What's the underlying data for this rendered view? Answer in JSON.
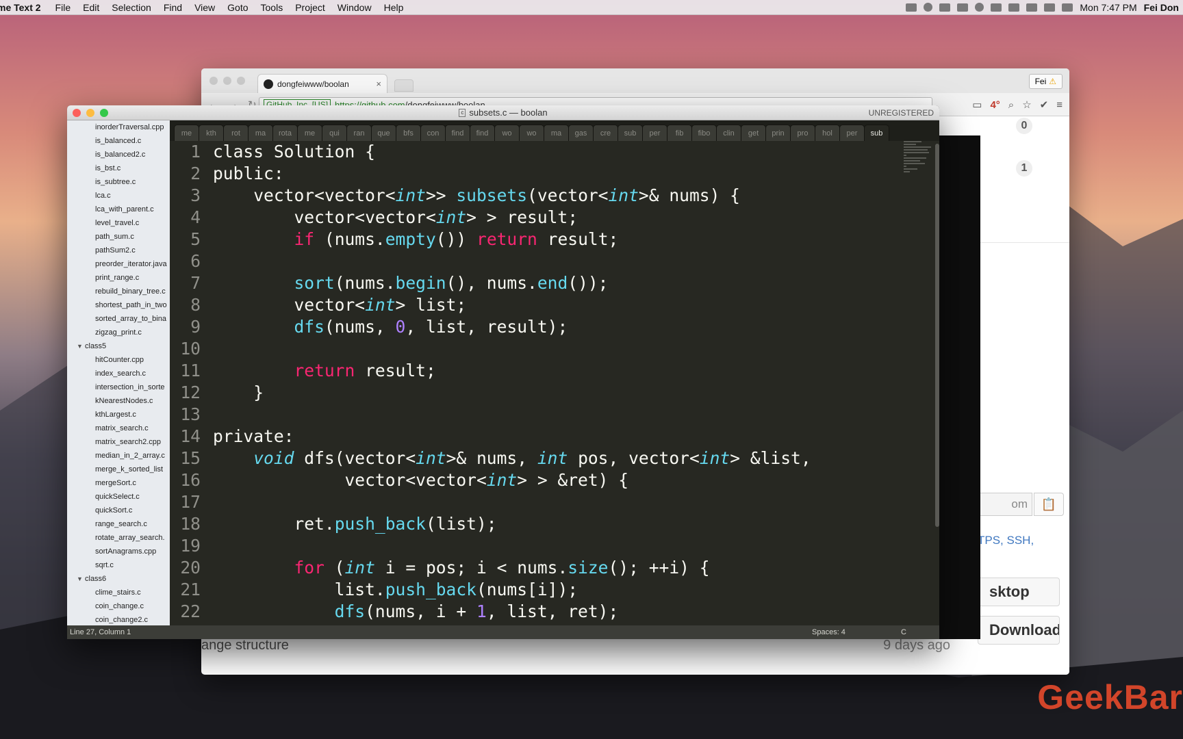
{
  "menubar": {
    "app_name": "me Text 2",
    "items": [
      "File",
      "Edit",
      "Selection",
      "Find",
      "View",
      "Goto",
      "Tools",
      "Project",
      "Window",
      "Help"
    ],
    "clock": "Mon 7:47 PM",
    "user": "Fei Don"
  },
  "browser": {
    "tab_title": "dongfeiwww/boolan",
    "tab_close": "×",
    "user_badge": "Fei",
    "warn_icon": "⚠",
    "ev_cert": "GitHub, Inc. [US]",
    "url_scheme_host": "https://github.com",
    "url_path": "/dongfeiwww/boolan",
    "temp": "4°",
    "counts": [
      "0",
      "1"
    ],
    "clone_partial": "om",
    "protocols_text": "TPS, SSH,",
    "open_desktop": "sktop",
    "download_zip": "Download ZIP",
    "commit_msg": "ange structure",
    "commit_age": "9 days ago"
  },
  "sublime": {
    "title": "subsets.c — boolan",
    "file_icon": "c",
    "unregistered": "UNREGISTERED",
    "sidebar": [
      {
        "type": "file",
        "name": "inorderTraversal.cpp"
      },
      {
        "type": "file",
        "name": "is_balanced.c"
      },
      {
        "type": "file",
        "name": "is_balanced2.c"
      },
      {
        "type": "file",
        "name": "is_bst.c"
      },
      {
        "type": "file",
        "name": "is_subtree.c"
      },
      {
        "type": "file",
        "name": "lca.c"
      },
      {
        "type": "file",
        "name": "lca_with_parent.c"
      },
      {
        "type": "file",
        "name": "level_travel.c"
      },
      {
        "type": "file",
        "name": "path_sum.c"
      },
      {
        "type": "file",
        "name": "pathSum2.c"
      },
      {
        "type": "file",
        "name": "preorder_iterator.java"
      },
      {
        "type": "file",
        "name": "print_range.c"
      },
      {
        "type": "file",
        "name": "rebuild_binary_tree.c"
      },
      {
        "type": "file",
        "name": "shortest_path_in_two"
      },
      {
        "type": "file",
        "name": "sorted_array_to_bina"
      },
      {
        "type": "file",
        "name": "zigzag_print.c"
      },
      {
        "type": "folder",
        "name": "class5"
      },
      {
        "type": "file",
        "name": "hitCounter.cpp"
      },
      {
        "type": "file",
        "name": "index_search.c"
      },
      {
        "type": "file",
        "name": "intersection_in_sorte"
      },
      {
        "type": "file",
        "name": "kNearestNodes.c"
      },
      {
        "type": "file",
        "name": "kthLargest.c"
      },
      {
        "type": "file",
        "name": "matrix_search.c"
      },
      {
        "type": "file",
        "name": "matrix_search2.cpp"
      },
      {
        "type": "file",
        "name": "median_in_2_array.c"
      },
      {
        "type": "file",
        "name": "merge_k_sorted_list"
      },
      {
        "type": "file",
        "name": "mergeSort.c"
      },
      {
        "type": "file",
        "name": "quickSelect.c"
      },
      {
        "type": "file",
        "name": "quickSort.c"
      },
      {
        "type": "file",
        "name": "range_search.c"
      },
      {
        "type": "file",
        "name": "rotate_array_search."
      },
      {
        "type": "file",
        "name": "sortAnagrams.cpp"
      },
      {
        "type": "file",
        "name": "sqrt.c"
      },
      {
        "type": "folder",
        "name": "class6"
      },
      {
        "type": "file",
        "name": "clime_stairs.c"
      },
      {
        "type": "file",
        "name": "coin_change.c"
      },
      {
        "type": "file",
        "name": "coin_change2.c"
      }
    ],
    "tabs": [
      "me",
      "kth",
      "rot",
      "ma",
      "rota",
      "me",
      "qui",
      "ran",
      "que",
      "bfs",
      "con",
      "find",
      "find",
      "wo",
      "wo",
      "ma",
      "gas",
      "cre",
      "sub",
      "per",
      "fib",
      "fibo",
      "clin",
      "get",
      "prin",
      "pro",
      "hol",
      "per",
      "sub"
    ],
    "active_tab_index": 28,
    "code_lines": [
      {
        "n": "1",
        "tokens": [
          [
            "",
            "class Solution {"
          ]
        ]
      },
      {
        "n": "2",
        "tokens": [
          [
            "",
            "public:"
          ]
        ]
      },
      {
        "n": "3",
        "tokens": [
          [
            "",
            "    vector<vector<"
          ],
          [
            "ty",
            "int"
          ],
          [
            "",
            ">> "
          ],
          [
            "fn",
            "subsets"
          ],
          [
            "",
            "(vector<"
          ],
          [
            "ty",
            "int"
          ],
          [
            "",
            ">& nums) {"
          ]
        ]
      },
      {
        "n": "4",
        "tokens": [
          [
            "",
            "        vector<vector<"
          ],
          [
            "ty",
            "int"
          ],
          [
            "",
            "> > result;"
          ]
        ]
      },
      {
        "n": "5",
        "tokens": [
          [
            "kw",
            "        if"
          ],
          [
            "",
            " (nums."
          ],
          [
            "fn",
            "empty"
          ],
          [
            "",
            "()) "
          ],
          [
            "kw",
            "return"
          ],
          [
            "",
            " result;"
          ]
        ]
      },
      {
        "n": "6",
        "tokens": [
          [
            "",
            ""
          ]
        ]
      },
      {
        "n": "7",
        "tokens": [
          [
            "fn",
            "        sort"
          ],
          [
            "",
            "(nums."
          ],
          [
            "fn",
            "begin"
          ],
          [
            "",
            "(), nums."
          ],
          [
            "fn",
            "end"
          ],
          [
            "",
            "());"
          ]
        ]
      },
      {
        "n": "8",
        "tokens": [
          [
            "",
            "        vector<"
          ],
          [
            "ty",
            "int"
          ],
          [
            "",
            "> list;"
          ]
        ]
      },
      {
        "n": "9",
        "tokens": [
          [
            "fn",
            "        dfs"
          ],
          [
            "",
            "(nums, "
          ],
          [
            "nu",
            "0"
          ],
          [
            "",
            ", list, result);"
          ]
        ]
      },
      {
        "n": "10",
        "tokens": [
          [
            "",
            ""
          ]
        ]
      },
      {
        "n": "11",
        "tokens": [
          [
            "kw",
            "        return"
          ],
          [
            "",
            " result;"
          ]
        ]
      },
      {
        "n": "12",
        "tokens": [
          [
            "",
            "    }"
          ]
        ]
      },
      {
        "n": "13",
        "tokens": [
          [
            "",
            ""
          ]
        ]
      },
      {
        "n": "14",
        "tokens": [
          [
            "",
            "private:"
          ]
        ]
      },
      {
        "n": "15",
        "tokens": [
          [
            "ty",
            "    void"
          ],
          [
            "",
            " dfs(vector<"
          ],
          [
            "ty",
            "int"
          ],
          [
            "",
            ">& nums, "
          ],
          [
            "ty",
            "int"
          ],
          [
            "",
            " pos, vector<"
          ],
          [
            "ty",
            "int"
          ],
          [
            "",
            "> &list,"
          ]
        ]
      },
      {
        "n": "16",
        "tokens": [
          [
            "",
            "             vector<vector<"
          ],
          [
            "ty",
            "int"
          ],
          [
            "",
            "> > &ret) {"
          ]
        ]
      },
      {
        "n": "17",
        "tokens": [
          [
            "",
            ""
          ]
        ]
      },
      {
        "n": "18",
        "tokens": [
          [
            "",
            "        ret."
          ],
          [
            "fn",
            "push_back"
          ],
          [
            "",
            "(list);"
          ]
        ]
      },
      {
        "n": "19",
        "tokens": [
          [
            "",
            ""
          ]
        ]
      },
      {
        "n": "20",
        "tokens": [
          [
            "kw",
            "        for"
          ],
          [
            "",
            " ("
          ],
          [
            "ty",
            "int"
          ],
          [
            "",
            " i = pos; i < nums."
          ],
          [
            "fn",
            "size"
          ],
          [
            "",
            "(); ++i) {"
          ]
        ]
      },
      {
        "n": "21",
        "tokens": [
          [
            "",
            "            list."
          ],
          [
            "fn",
            "push_back"
          ],
          [
            "",
            "(nums[i]);"
          ]
        ]
      },
      {
        "n": "22",
        "tokens": [
          [
            "fn",
            "            dfs"
          ],
          [
            "",
            "(nums, i + "
          ],
          [
            "nu",
            "1"
          ],
          [
            "",
            ", list, ret);"
          ]
        ]
      }
    ],
    "status": {
      "position": "Line 27, Column 1",
      "spaces": "Spaces: 4",
      "syntax": "C"
    }
  },
  "watermark": "GeekBar",
  "colors": {
    "editor_bg": "#272822",
    "keyword": "#f92672",
    "type": "#66d9ef",
    "number": "#ae81ff"
  }
}
